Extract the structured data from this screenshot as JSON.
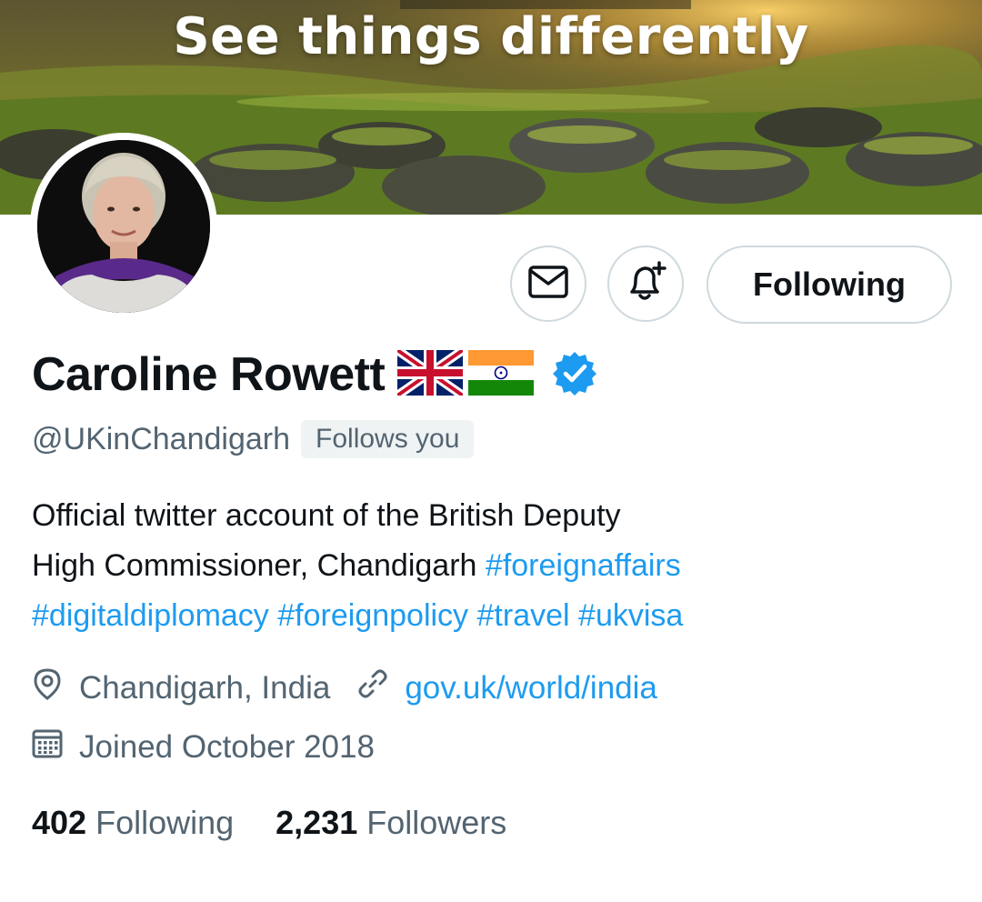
{
  "banner": {
    "headline": "See things differently"
  },
  "profile": {
    "name": "Caroline Rowett",
    "flags": [
      "uk-flag",
      "india-flag"
    ],
    "verified": true,
    "handle": "@UKinChandigarh",
    "follows_you": "Follows you",
    "bio": {
      "line1": "Official twitter account of the British Deputy",
      "line2_text": "High Commissioner, Chandigarh ",
      "hashtags": [
        "#foreignaffairs",
        "#digitaldiplomacy",
        "#foreignpolicy",
        "#travel",
        "#ukvisa"
      ]
    },
    "location": "Chandigarh, India",
    "website": "gov.uk/world/india",
    "joined": "Joined October 2018"
  },
  "actions": {
    "message_icon": "mail-icon",
    "notify_icon": "bell-plus-icon",
    "following_label": "Following"
  },
  "stats": {
    "following_count": "402",
    "following_label": "Following",
    "followers_count": "2,231",
    "followers_label": "Followers"
  },
  "colors": {
    "accent": "#1d9bf0",
    "text_primary": "#0f1419",
    "text_secondary": "#536471",
    "border": "#cfd9de"
  }
}
